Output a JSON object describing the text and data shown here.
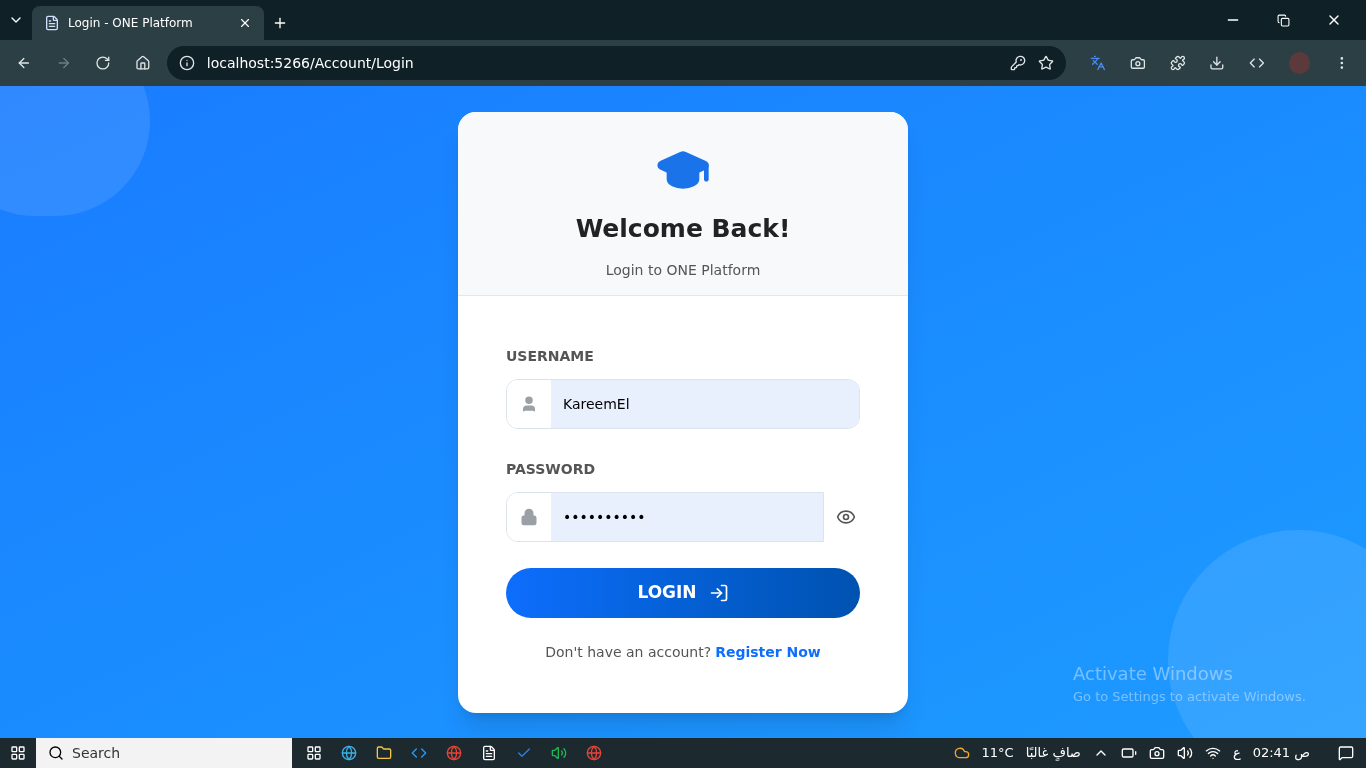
{
  "browser": {
    "tab": {
      "title": "Login - ONE Platform",
      "selected": true
    },
    "address": "localhost:5266/Account/Login"
  },
  "card": {
    "title": "Welcome Back!",
    "subtitle": "Login to ONE Platform",
    "fields": [
      {
        "kind": "text",
        "label": "USERNAME",
        "value": "KareemEl"
      },
      {
        "kind": "password",
        "label": "PASSWORD",
        "value": "••••••••••"
      }
    ],
    "login_button": "LOGIN",
    "register_prompt": "Don't have an account?",
    "register_link": "Register Now"
  },
  "activation_notice": {
    "title": "Activate Windows",
    "message": "Go to Settings to activate Windows."
  },
  "taskbar": {
    "search_placeholder": "Search",
    "temperature": "11°C",
    "weather": "صافٍ غالبًا",
    "language": "ع",
    "time": "02:41 ص"
  }
}
